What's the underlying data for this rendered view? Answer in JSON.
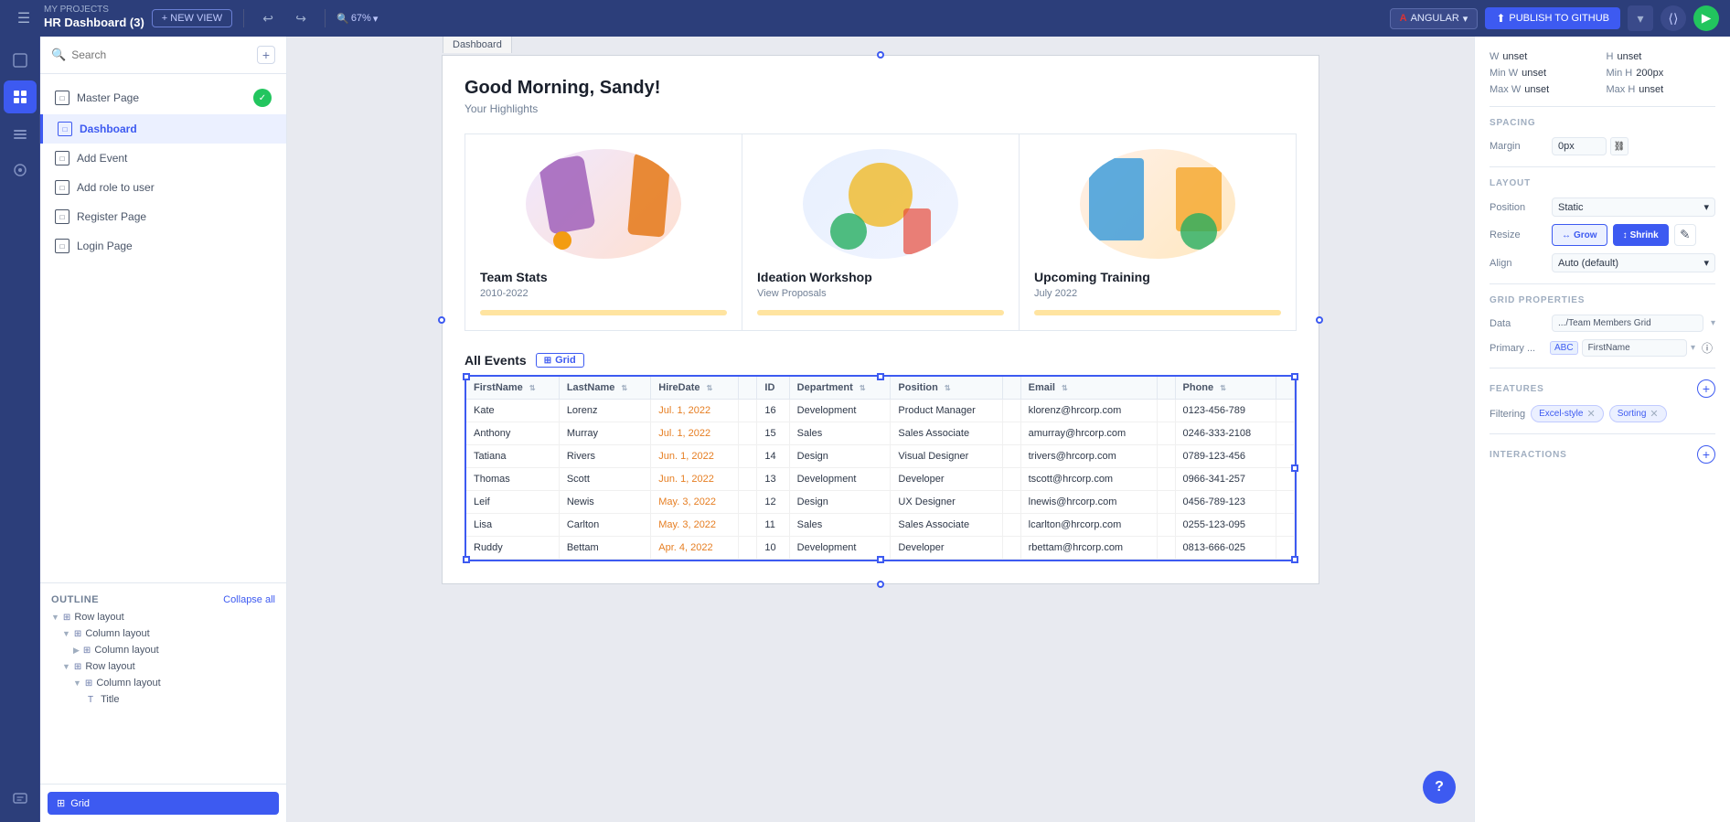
{
  "topbar": {
    "my_projects": "MY PROJECTS",
    "project_title": "HR Dashboard (3)",
    "new_view_label": "+ NEW VIEW",
    "zoom_level": "67%",
    "angular_label": "ANGULAR",
    "publish_label": "PUBLISH TO GITHUB"
  },
  "left_panel": {
    "search_placeholder": "Search",
    "add_tooltip": "+",
    "pages": [
      {
        "label": "Master Page",
        "active": false,
        "has_badge": true
      },
      {
        "label": "Dashboard",
        "active": true,
        "has_badge": false
      },
      {
        "label": "Add Event",
        "active": false,
        "has_badge": false
      },
      {
        "label": "Add role to user",
        "active": false,
        "has_badge": false
      },
      {
        "label": "Register Page",
        "active": false,
        "has_badge": false
      },
      {
        "label": "Login Page",
        "active": false,
        "has_badge": false
      }
    ],
    "outline": {
      "title": "OUTLINE",
      "collapse_all": "Collapse all",
      "items": [
        {
          "label": "Row layout",
          "indent": 0,
          "type": "row"
        },
        {
          "label": "Column layout",
          "indent": 1,
          "type": "col"
        },
        {
          "label": "Column layout",
          "indent": 2,
          "type": "col"
        },
        {
          "label": "Row layout",
          "indent": 2,
          "type": "row"
        },
        {
          "label": "Column layout",
          "indent": 3,
          "type": "col"
        },
        {
          "label": "Title",
          "indent": 4,
          "type": "text"
        }
      ]
    }
  },
  "canvas": {
    "tab_label": "Dashboard",
    "greeting": "Good Morning, Sandy!",
    "subtitle": "Your Highlights",
    "cards": [
      {
        "title": "Team Stats",
        "subtitle": "2010-2022"
      },
      {
        "title": "Ideation Workshop",
        "subtitle": "View Proposals"
      },
      {
        "title": "Upcoming Training",
        "subtitle": "July 2022"
      }
    ],
    "all_events_label": "All Events",
    "grid_badge": "Grid",
    "table": {
      "columns": [
        "FirstName",
        "LastName",
        "HireDate",
        "",
        "ID",
        "Department",
        "Position",
        "",
        "Email",
        "",
        "Phone",
        ""
      ],
      "rows": [
        {
          "firstName": "Kate",
          "lastName": "Lorenz",
          "hireDate": "Jul. 1, 2022",
          "id": "16",
          "department": "Development",
          "position": "Product Manager",
          "email": "klorenz@hrcorp.com",
          "phone": "0123-456-789"
        },
        {
          "firstName": "Anthony",
          "lastName": "Murray",
          "hireDate": "Jul. 1, 2022",
          "id": "15",
          "department": "Sales",
          "position": "Sales Associate",
          "email": "amurray@hrcorp.com",
          "phone": "0246-333-2108"
        },
        {
          "firstName": "Tatiana",
          "lastName": "Rivers",
          "hireDate": "Jun. 1, 2022",
          "id": "14",
          "department": "Design",
          "position": "Visual Designer",
          "email": "trivers@hrcorp.com",
          "phone": "0789-123-456"
        },
        {
          "firstName": "Thomas",
          "lastName": "Scott",
          "hireDate": "Jun. 1, 2022",
          "id": "13",
          "department": "Development",
          "position": "Developer",
          "email": "tscott@hrcorp.com",
          "phone": "0966-341-257"
        },
        {
          "firstName": "Leif",
          "lastName": "Newis",
          "hireDate": "May. 3, 2022",
          "id": "12",
          "department": "Design",
          "position": "UX Designer",
          "email": "lnewis@hrcorp.com",
          "phone": "0456-789-123"
        },
        {
          "firstName": "Lisa",
          "lastName": "Carlton",
          "hireDate": "May. 3, 2022",
          "id": "11",
          "department": "Sales",
          "position": "Sales Associate",
          "email": "lcarlton@hrcorp.com",
          "phone": "0255-123-095"
        },
        {
          "firstName": "Ruddy",
          "lastName": "Bettam",
          "hireDate": "Apr. 4, 2022",
          "id": "10",
          "department": "Development",
          "position": "Developer",
          "email": "rbettam@hrcorp.com",
          "phone": "0813-666-025"
        }
      ]
    }
  },
  "right_panel": {
    "w_label": "W",
    "w_value": "unset",
    "h_label": "H",
    "h_value": "unset",
    "min_w_label": "Min W",
    "min_w_value": "unset",
    "min_h_label": "Min H",
    "min_h_value": "200px",
    "max_w_label": "Max W",
    "max_w_value": "unset",
    "max_h_label": "Max H",
    "max_h_value": "unset",
    "spacing_title": "SPACING",
    "margin_label": "Margin",
    "margin_value": "0px",
    "layout_title": "LAYOUT",
    "position_label": "Position",
    "position_value": "Static",
    "resize_label": "Resize",
    "grow_label": "Grow",
    "shrink_label": "Shrink",
    "align_label": "Align",
    "align_value": "Auto (default)",
    "grid_props_title": "GRID PROPERTIES",
    "data_label": "Data",
    "data_value": ".../Team Members Grid",
    "primary_label": "Primary ...",
    "primary_value": "FirstName",
    "features_title": "FEATURES",
    "filtering_label": "Filtering",
    "excel_style_label": "Excel-style",
    "sorting_label": "Sorting",
    "interactions_title": "INTERACTIONS"
  }
}
